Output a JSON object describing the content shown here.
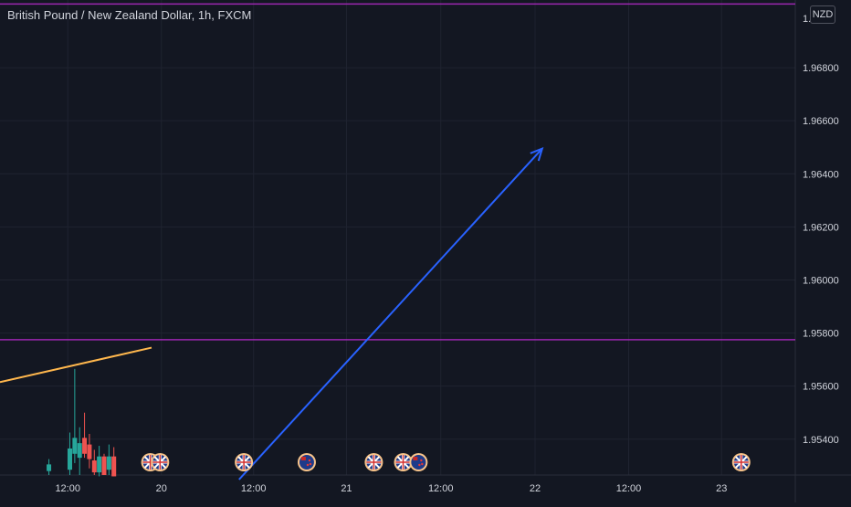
{
  "header": {
    "title": "British Pound / New Zealand Dollar, 1h, FXCM",
    "currency_badge": "NZD"
  },
  "colors": {
    "background": "#131722",
    "grid": "#1f2330",
    "axis_text": "#d1d4dc",
    "bullish": "#26a69a",
    "bearish": "#ef5350",
    "horizontal_line": "#9c27b0",
    "trend_line": "#ffb74d",
    "arrow": "#2962ff"
  },
  "chart_data": {
    "type": "candlestick",
    "y_axis": {
      "ticks": [
        "1.96800",
        "1.96600",
        "1.96400",
        "1.96200",
        "1.96000",
        "1.95800",
        "1.95600",
        "1.95400"
      ],
      "top_tick_partial": "1.9",
      "range": [
        1.95265,
        1.97055
      ]
    },
    "x_axis": {
      "ticks": [
        "12:00",
        "20",
        "12:00",
        "21",
        "12:00",
        "22",
        "12:00",
        "23"
      ]
    },
    "horizontal_lines": [
      {
        "price": 1.9704
      },
      {
        "price": 1.95775
      }
    ],
    "trend_line": {
      "from": [
        0.0,
        1.95615
      ],
      "to": [
        10.0,
        1.95745
      ]
    },
    "arrow": {
      "from": [
        16.0,
        1.95255
      ],
      "to": [
        36.0,
        1.96495
      ]
    },
    "candles": [
      {
        "t": 3.5,
        "o": 1.9528,
        "h": 1.95325,
        "l": 1.95265,
        "c": 1.95305
      },
      {
        "t": 5.0,
        "o": 1.95285,
        "h": 1.95425,
        "l": 1.95265,
        "c": 1.95365
      },
      {
        "t": 5.35,
        "o": 1.95345,
        "h": 1.95665,
        "l": 1.9531,
        "c": 1.95405
      },
      {
        "t": 5.7,
        "o": 1.9533,
        "h": 1.95445,
        "l": 1.95265,
        "c": 1.95385
      },
      {
        "t": 6.05,
        "o": 1.95405,
        "h": 1.955,
        "l": 1.9533,
        "c": 1.95345
      },
      {
        "t": 6.4,
        "o": 1.9538,
        "h": 1.9542,
        "l": 1.9529,
        "c": 1.95325
      },
      {
        "t": 6.75,
        "o": 1.9532,
        "h": 1.9536,
        "l": 1.95265,
        "c": 1.95275
      },
      {
        "t": 7.1,
        "o": 1.95275,
        "h": 1.95375,
        "l": 1.9526,
        "c": 1.95335
      },
      {
        "t": 7.45,
        "o": 1.95335,
        "h": 1.95345,
        "l": 1.95265,
        "c": 1.95265
      },
      {
        "t": 7.8,
        "o": 1.95285,
        "h": 1.9538,
        "l": 1.95265,
        "c": 1.95335
      },
      {
        "t": 8.15,
        "o": 1.95335,
        "h": 1.9537,
        "l": 1.9526,
        "c": 1.9526
      }
    ],
    "events": [
      {
        "t": 10.3,
        "flag": "gb"
      },
      {
        "t": 11.0,
        "flag": "gb"
      },
      {
        "t": 17.0,
        "flag": "gb"
      },
      {
        "t": 21.5,
        "flag": "nz"
      },
      {
        "t": 26.3,
        "flag": "gb"
      },
      {
        "t": 28.4,
        "flag": "gb"
      },
      {
        "t": 29.5,
        "flag": "nz"
      },
      {
        "t": 52.6,
        "flag": "gb"
      }
    ]
  }
}
